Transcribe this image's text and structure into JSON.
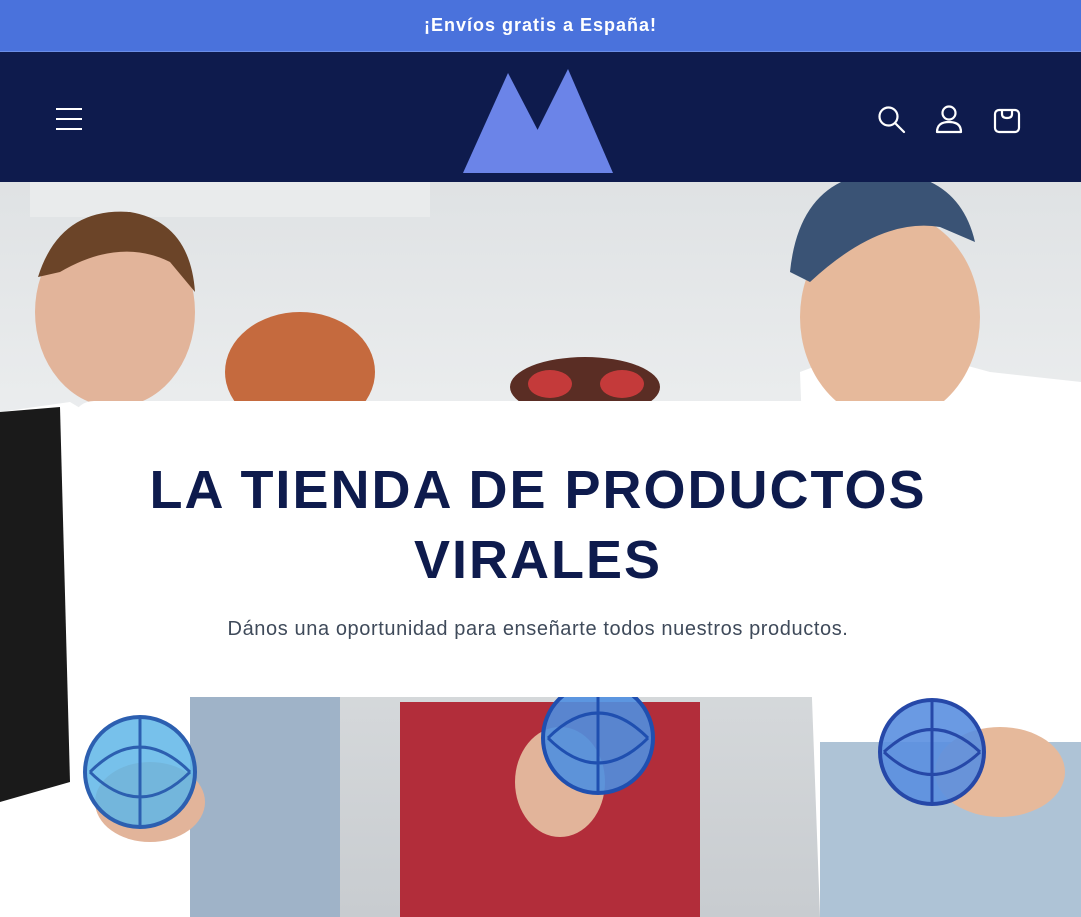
{
  "announcement": {
    "text": "¡Envíos gratis a España!"
  },
  "header": {
    "menu_icon": "hamburger-menu-icon",
    "logo": "brand-logo-m",
    "icons": [
      "search-icon",
      "account-icon",
      "cart-icon"
    ]
  },
  "colors": {
    "announcement_bg": "#4a72dc",
    "header_bg": "#0e1b4d",
    "logo": "#6b84e8",
    "heading": "#0e1b4d"
  },
  "hero": {
    "title": "LA TIENDA DE PRODUCTOS VIRALES",
    "subtitle": "Dános una oportunidad para enseñarte todos nuestros productos."
  }
}
